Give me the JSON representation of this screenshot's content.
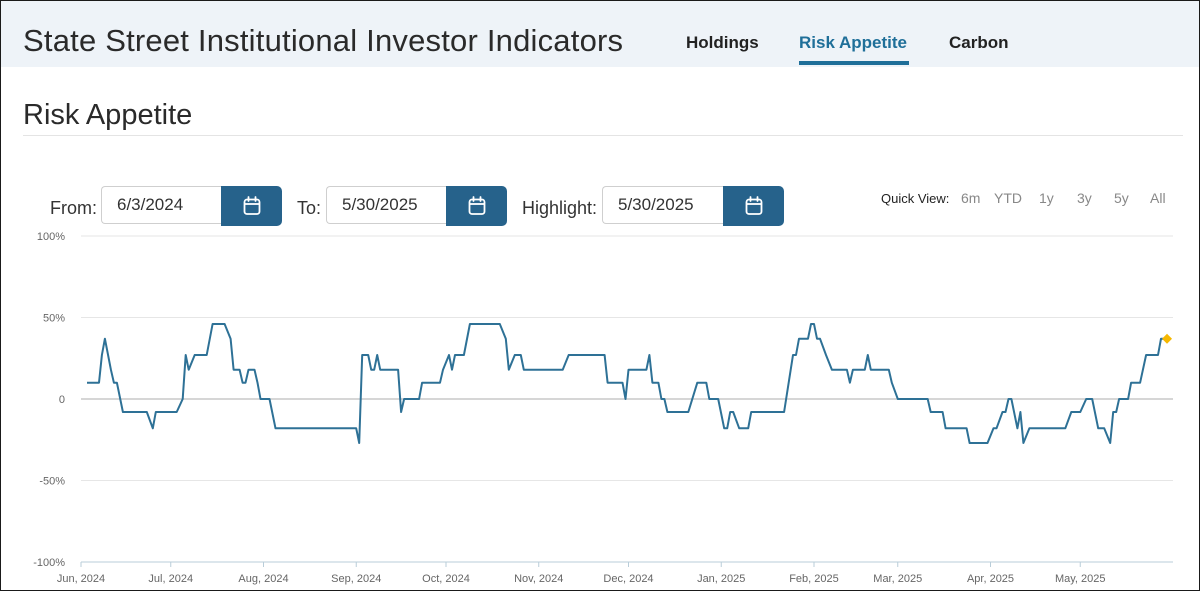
{
  "header": {
    "title": "State Street Institutional Investor Indicators",
    "tabs": [
      {
        "label": "Holdings"
      },
      {
        "label": "Risk Appetite",
        "active": true
      },
      {
        "label": "Carbon"
      }
    ],
    "accent_color": "#1f6f99"
  },
  "section": {
    "title": "Risk Appetite"
  },
  "controls": {
    "from_label": "From:",
    "from_value": "6/3/2024",
    "to_label": "To:",
    "to_value": "5/30/2025",
    "highlight_label": "Highlight:",
    "highlight_value": "5/30/2025",
    "calendar_icon": "calendar-icon",
    "button_color": "#26628b",
    "quick_view_label": "Quick View:",
    "quick_view_options": [
      "6m",
      "YTD",
      "1y",
      "3y",
      "5y",
      "All"
    ]
  },
  "chart_data": {
    "type": "line",
    "title": "",
    "xlabel": "",
    "ylabel": "",
    "ylim": [
      -100,
      100
    ],
    "yticks": [
      "100%",
      "50%",
      "0",
      "-50%",
      "-100%"
    ],
    "xticks": [
      "Jun, 2024",
      "Jul, 2024",
      "Aug, 2024",
      "Sep, 2024",
      "Oct, 2024",
      "Nov, 2024",
      "Dec, 2024",
      "Jan, 2025",
      "Feb, 2025",
      "Mar, 2025",
      "Apr, 2025",
      "May, 2025"
    ],
    "xtick_dates": [
      "2024-06-01",
      "2024-07-01",
      "2024-08-01",
      "2024-09-01",
      "2024-10-01",
      "2024-11-01",
      "2024-12-01",
      "2025-01-01",
      "2025-02-01",
      "2025-03-01",
      "2025-04-01",
      "2025-05-01"
    ],
    "xlim": [
      "2024-06-01",
      "2025-06-01"
    ],
    "grid": true,
    "line_color": "#2e7196",
    "highlight_color": "#f6b800",
    "highlight": {
      "x": "2025-05-30",
      "y": 37
    },
    "series": [
      {
        "points": [
          [
            "2024-06-03",
            10
          ],
          [
            "2024-06-07",
            10
          ],
          [
            "2024-06-08",
            27
          ],
          [
            "2024-06-09",
            37
          ],
          [
            "2024-06-11",
            18
          ],
          [
            "2024-06-12",
            10
          ],
          [
            "2024-06-13",
            10
          ],
          [
            "2024-06-15",
            -8
          ],
          [
            "2024-06-23",
            -8
          ],
          [
            "2024-06-25",
            -18
          ],
          [
            "2024-06-26",
            -8
          ],
          [
            "2024-07-03",
            -8
          ],
          [
            "2024-07-05",
            0
          ],
          [
            "2024-07-06",
            27
          ],
          [
            "2024-07-07",
            18
          ],
          [
            "2024-07-09",
            27
          ],
          [
            "2024-07-13",
            27
          ],
          [
            "2024-07-15",
            46
          ],
          [
            "2024-07-19",
            46
          ],
          [
            "2024-07-21",
            37
          ],
          [
            "2024-07-22",
            18
          ],
          [
            "2024-07-24",
            18
          ],
          [
            "2024-07-25",
            10
          ],
          [
            "2024-07-26",
            10
          ],
          [
            "2024-07-27",
            18
          ],
          [
            "2024-07-29",
            18
          ],
          [
            "2024-07-30",
            10
          ],
          [
            "2024-07-31",
            0
          ],
          [
            "2024-08-03",
            0
          ],
          [
            "2024-08-05",
            -18
          ],
          [
            "2024-09-01",
            -18
          ],
          [
            "2024-09-02",
            -27
          ],
          [
            "2024-09-03",
            27
          ],
          [
            "2024-09-05",
            27
          ],
          [
            "2024-09-06",
            18
          ],
          [
            "2024-09-07",
            18
          ],
          [
            "2024-09-08",
            27
          ],
          [
            "2024-09-09",
            18
          ],
          [
            "2024-09-15",
            18
          ],
          [
            "2024-09-16",
            -8
          ],
          [
            "2024-09-17",
            0
          ],
          [
            "2024-09-22",
            0
          ],
          [
            "2024-09-23",
            10
          ],
          [
            "2024-09-29",
            10
          ],
          [
            "2024-09-30",
            18
          ],
          [
            "2024-10-02",
            27
          ],
          [
            "2024-10-03",
            18
          ],
          [
            "2024-10-04",
            27
          ],
          [
            "2024-10-07",
            27
          ],
          [
            "2024-10-09",
            46
          ],
          [
            "2024-10-19",
            46
          ],
          [
            "2024-10-21",
            37
          ],
          [
            "2024-10-22",
            18
          ],
          [
            "2024-10-24",
            27
          ],
          [
            "2024-10-26",
            27
          ],
          [
            "2024-10-27",
            18
          ],
          [
            "2024-11-09",
            18
          ],
          [
            "2024-11-11",
            27
          ],
          [
            "2024-11-23",
            27
          ],
          [
            "2024-11-24",
            10
          ],
          [
            "2024-11-29",
            10
          ],
          [
            "2024-11-30",
            0
          ],
          [
            "2024-12-01",
            18
          ],
          [
            "2024-12-07",
            18
          ],
          [
            "2024-12-08",
            27
          ],
          [
            "2024-12-09",
            10
          ],
          [
            "2024-12-11",
            10
          ],
          [
            "2024-12-12",
            0
          ],
          [
            "2024-12-13",
            0
          ],
          [
            "2024-12-14",
            -8
          ],
          [
            "2024-12-21",
            -8
          ],
          [
            "2024-12-24",
            10
          ],
          [
            "2024-12-27",
            10
          ],
          [
            "2024-12-28",
            0
          ],
          [
            "2024-12-31",
            0
          ],
          [
            "2025-01-02",
            -18
          ],
          [
            "2025-01-03",
            -18
          ],
          [
            "2025-01-04",
            -8
          ],
          [
            "2025-01-05",
            -8
          ],
          [
            "2025-01-07",
            -18
          ],
          [
            "2025-01-10",
            -18
          ],
          [
            "2025-01-11",
            -8
          ],
          [
            "2025-01-22",
            -8
          ],
          [
            "2025-01-25",
            27
          ],
          [
            "2025-01-26",
            27
          ],
          [
            "2025-01-27",
            37
          ],
          [
            "2025-01-30",
            37
          ],
          [
            "2025-01-31",
            46
          ],
          [
            "2025-02-01",
            46
          ],
          [
            "2025-02-02",
            37
          ],
          [
            "2025-02-03",
            37
          ],
          [
            "2025-02-05",
            27
          ],
          [
            "2025-02-07",
            18
          ],
          [
            "2025-02-12",
            18
          ],
          [
            "2025-02-13",
            10
          ],
          [
            "2025-02-14",
            18
          ],
          [
            "2025-02-18",
            18
          ],
          [
            "2025-02-19",
            27
          ],
          [
            "2025-02-20",
            18
          ],
          [
            "2025-02-26",
            18
          ],
          [
            "2025-02-27",
            10
          ],
          [
            "2025-03-01",
            0
          ],
          [
            "2025-03-11",
            0
          ],
          [
            "2025-03-12",
            -8
          ],
          [
            "2025-03-16",
            -8
          ],
          [
            "2025-03-17",
            -18
          ],
          [
            "2025-03-24",
            -18
          ],
          [
            "2025-03-25",
            -27
          ],
          [
            "2025-03-31",
            -27
          ],
          [
            "2025-04-02",
            -18
          ],
          [
            "2025-04-03",
            -18
          ],
          [
            "2025-04-05",
            -8
          ],
          [
            "2025-04-06",
            -8
          ],
          [
            "2025-04-07",
            0
          ],
          [
            "2025-04-08",
            0
          ],
          [
            "2025-04-10",
            -18
          ],
          [
            "2025-04-11",
            -8
          ],
          [
            "2025-04-12",
            -27
          ],
          [
            "2025-04-14",
            -18
          ],
          [
            "2025-04-26",
            -18
          ],
          [
            "2025-04-28",
            -8
          ],
          [
            "2025-05-01",
            -8
          ],
          [
            "2025-05-03",
            0
          ],
          [
            "2025-05-05",
            0
          ],
          [
            "2025-05-07",
            -18
          ],
          [
            "2025-05-09",
            -18
          ],
          [
            "2025-05-11",
            -27
          ],
          [
            "2025-05-12",
            -8
          ],
          [
            "2025-05-13",
            -8
          ],
          [
            "2025-05-14",
            0
          ],
          [
            "2025-05-17",
            0
          ],
          [
            "2025-05-18",
            10
          ],
          [
            "2025-05-21",
            10
          ],
          [
            "2025-05-23",
            27
          ],
          [
            "2025-05-27",
            27
          ],
          [
            "2025-05-28",
            37
          ],
          [
            "2025-05-30",
            37
          ]
        ]
      }
    ]
  }
}
